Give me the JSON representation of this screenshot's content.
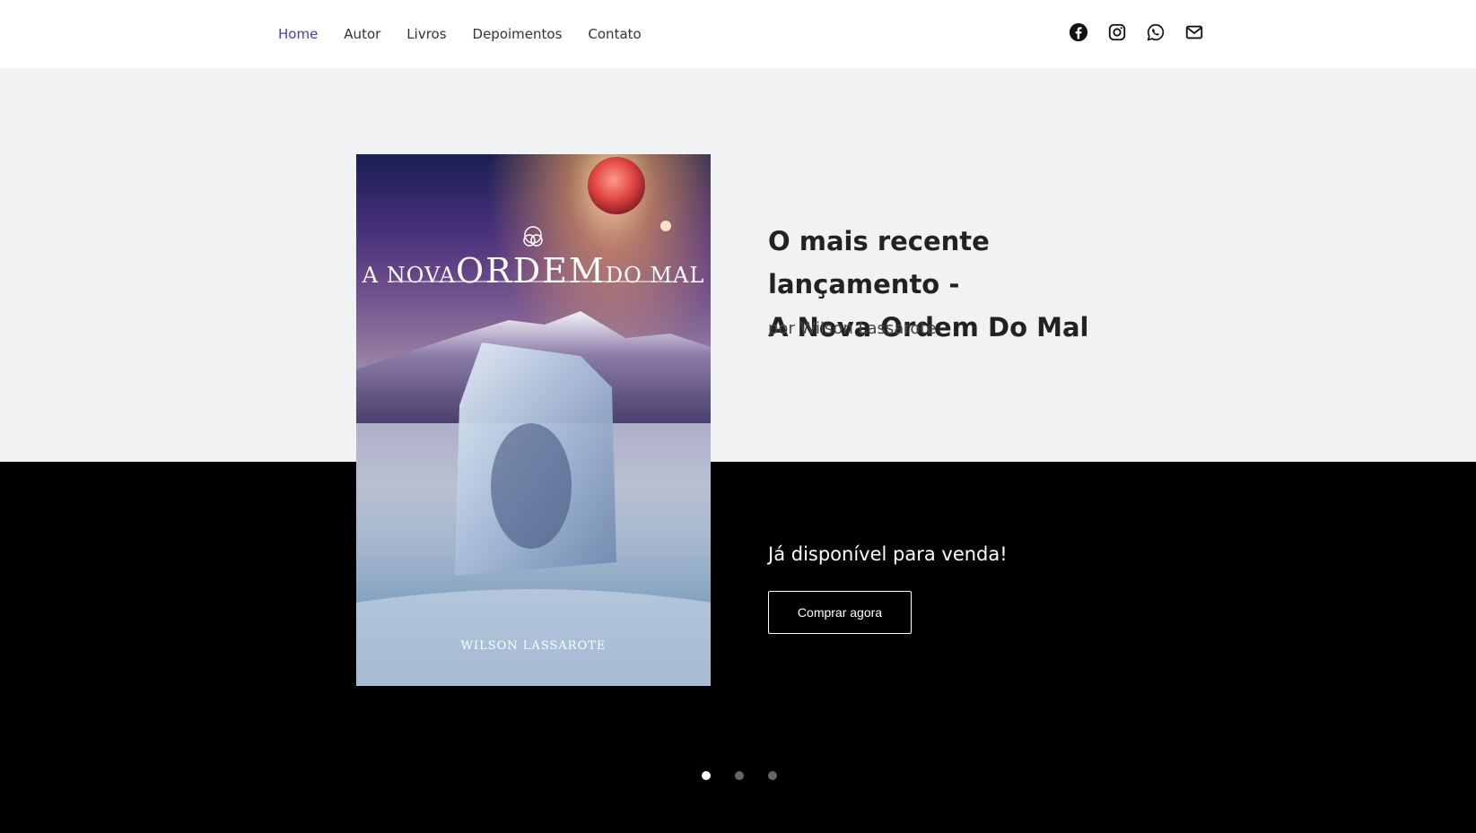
{
  "nav": {
    "items": [
      {
        "label": "Home",
        "active": true
      },
      {
        "label": "Autor",
        "active": false
      },
      {
        "label": "Livros",
        "active": false
      },
      {
        "label": "Depoimentos",
        "active": false
      },
      {
        "label": "Contato",
        "active": false
      }
    ],
    "active_color": "#3f3fbf"
  },
  "social": {
    "icons": [
      "facebook-icon",
      "instagram-icon",
      "whatsapp-icon",
      "mail-icon"
    ]
  },
  "hero": {
    "headline_line1": "O mais recente lançamento -",
    "headline_line2": "A Nova Ordem Do Mal",
    "byline": "por Wilson Lassarote",
    "available": "Já disponível para venda!",
    "buy_label": "Comprar agora",
    "top_bg": "#f1f2f4",
    "bottom_bg": "#000000"
  },
  "cover": {
    "title_prefix": "A NOVA",
    "title_main": "ORDEM",
    "title_suffix": "DO MAL",
    "author": "WILSON LASSAROTE"
  },
  "carousel": {
    "slide_count": 3,
    "active_index": 0
  }
}
